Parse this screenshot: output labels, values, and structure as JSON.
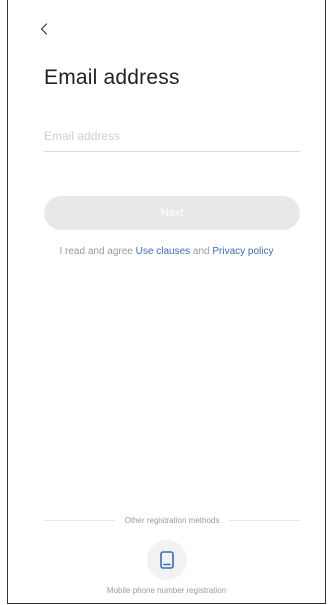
{
  "header": {
    "back_icon": "chevron-left-icon",
    "title": "Email address"
  },
  "form": {
    "email_value": "",
    "email_placeholder": "Email address",
    "next_label": "Next",
    "next_enabled": false
  },
  "agreement": {
    "prefix": "I read and agree ",
    "use_clauses": "Use clauses",
    "conjunction": " and ",
    "privacy_policy": "Privacy policy"
  },
  "other_methods": {
    "divider_label": "Other registration methods",
    "methods": [
      {
        "icon": "phone-icon",
        "label": "Mobile phone number registration"
      }
    ]
  },
  "colors": {
    "link": "#3a6fb0",
    "button_disabled_bg": "#e8e8e8",
    "icon_accent": "#3a6fb0",
    "muted_text": "#9a9a9a"
  }
}
